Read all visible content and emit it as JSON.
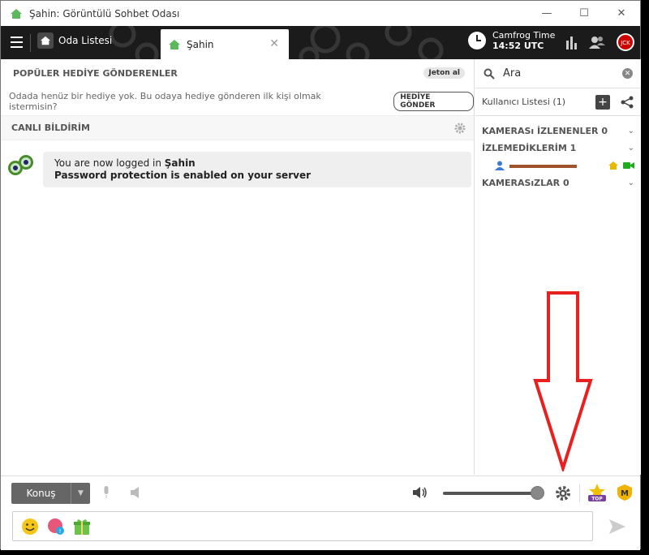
{
  "window": {
    "title": "Şahin: Görüntülü Sohbet Odası"
  },
  "topbar": {
    "room_list_label": "Oda Listesi",
    "tab_label": "Şahin",
    "camfrog_time_label": "Camfrog Time",
    "camfrog_time_value": "14:52 UTC"
  },
  "gifts": {
    "header": "POPÜLER HEDİYE GÖNDERENLER",
    "jeton_button": "Jeton al",
    "empty_text": "Odada henüz bir hediye yok. Bu odaya hediye gönderen ilk kişi olmak istermisin?",
    "send_button": "HEDİYE GÖNDER"
  },
  "live": {
    "header": "CANLI BİLDİRİM"
  },
  "message": {
    "line1_prefix": "You are now logged in ",
    "line1_name": "Şahin",
    "line2": "Password protection is enabled on your server"
  },
  "sidebar": {
    "search_placeholder": "Ara",
    "user_list_label": "Kullanıcı Listesi (1)",
    "sections": [
      {
        "label": "KAMERASı İZLENENLER 0"
      },
      {
        "label": "İZLEMEDİKLERİM 1"
      },
      {
        "label": "KAMERASıZLAR 0"
      }
    ],
    "user": {
      "name": "~~~~~~~~~"
    }
  },
  "bottom": {
    "talk_button": "Konuş",
    "volume_level": 1.0
  },
  "colors": {
    "accent_green": "#5cb85c",
    "arrow_red": "#e82020",
    "user_gold": "#e8a000"
  }
}
